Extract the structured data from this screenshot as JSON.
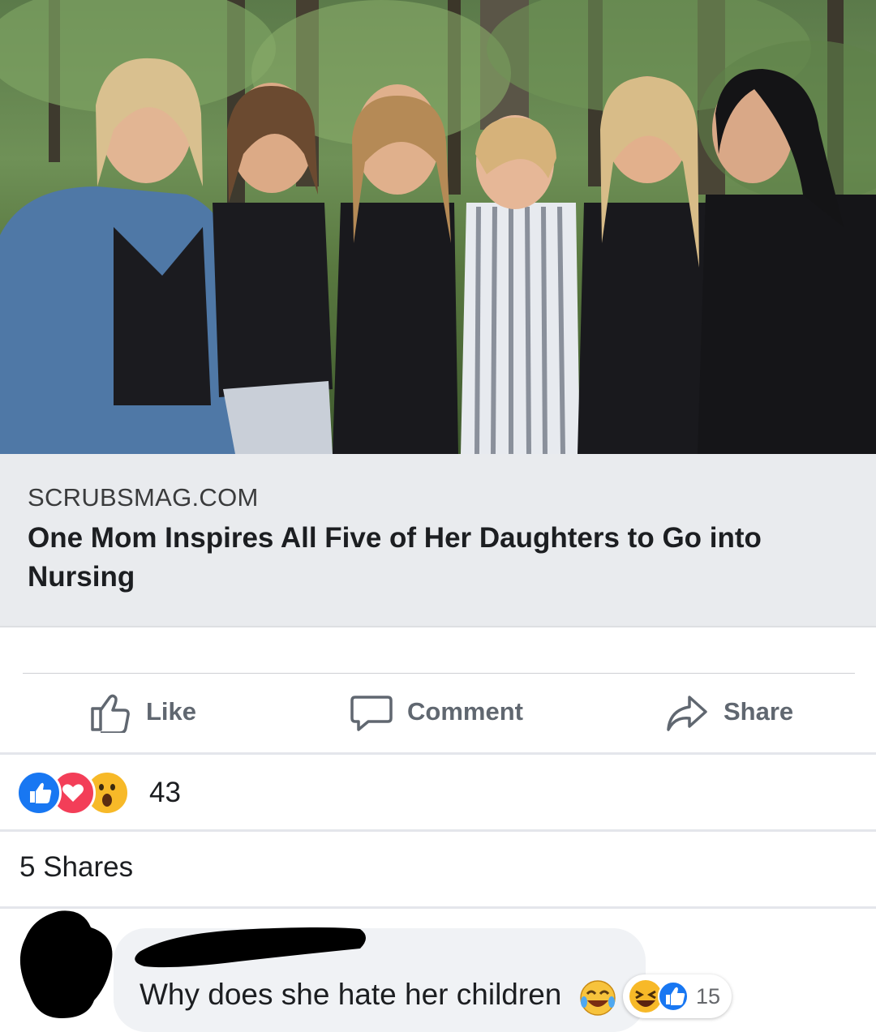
{
  "post": {
    "link": {
      "domain": "SCRUBSMAG.COM",
      "title": "One Mom Inspires All Five of Her Daughters to Go into Nursing"
    }
  },
  "actions": {
    "like_label": "Like",
    "comment_label": "Comment",
    "share_label": "Share"
  },
  "reactions": {
    "icons": [
      "like-reaction",
      "love-reaction",
      "wow-reaction"
    ],
    "count": "43"
  },
  "shares_text": "5 Shares",
  "comment": {
    "text": "Why does she hate her children",
    "emoji": "laughing-tears-emoji",
    "reactions": [
      "haha-reaction",
      "like-reaction"
    ],
    "reaction_count": "15"
  },
  "colors": {
    "like_blue": "#1877f2",
    "love_red": "#f33e58",
    "wow_yellow": "#f7b928",
    "link_bg": "#e9ebee",
    "action_gray": "#606770"
  }
}
